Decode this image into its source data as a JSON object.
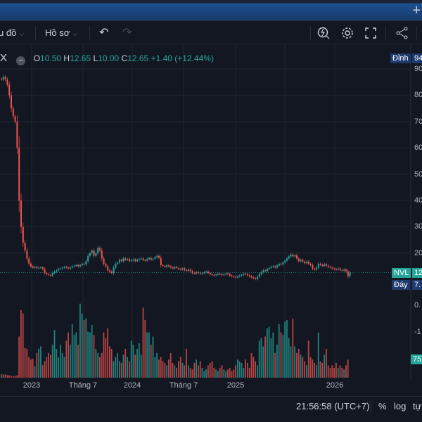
{
  "topbar": {
    "add_label": "+"
  },
  "toolbar": {
    "chart_menu": "u đồ",
    "profile_menu": "Hồ sơ",
    "undo": "↶",
    "redo": "↷"
  },
  "legend": {
    "symbol": "X",
    "o_label": "O",
    "o": "10.50",
    "h_label": "H",
    "h": "12.65",
    "l_label": "L",
    "l": "10.00",
    "c_label": "C",
    "c": "12.65",
    "change": "+1.40 (+12.44%)"
  },
  "price_axis": {
    "labels": [
      "90",
      "80",
      "70",
      "60",
      "50",
      "40",
      "30",
      "20"
    ],
    "high_label": "Đỉnh",
    "high_value": "94",
    "symbol_tag": "NVL",
    "last_value": "12",
    "low_label": "Đáy",
    "low_value": "7.",
    "osc_labels": [
      "0.",
      "-1"
    ],
    "volume_tag": "75"
  },
  "time_axis": [
    "2023",
    "Tháng 7",
    "2024",
    "Tháng 7",
    "2025",
    "2026"
  ],
  "bottom": {
    "time": "21:56:58 (UTC+7)",
    "percent": "%",
    "log": "log",
    "auto": "tự"
  },
  "colors": {
    "up": "#26a69a",
    "down": "#ef5350",
    "bg": "#131722",
    "accent": "#1e4f8f"
  },
  "chart_data": {
    "type": "candlestick",
    "symbol": "NVL",
    "interval": "weekly",
    "ylim": [
      0,
      95
    ],
    "closes": [
      86,
      87,
      86,
      84,
      80,
      75,
      72,
      70,
      60,
      40,
      30,
      24,
      21,
      18,
      16,
      15,
      14.5,
      14.8,
      14.3,
      14.5,
      14.6,
      14,
      12.5,
      12,
      11.8,
      11.5,
      12.5,
      13,
      13.5,
      14,
      14.2,
      14.5,
      14.8,
      14.5,
      14.2,
      14.6,
      15,
      15.2,
      15.5,
      15,
      15.5,
      16,
      15.8,
      17,
      19,
      20,
      21,
      19,
      20,
      22,
      21,
      18,
      16,
      15,
      13.5,
      13,
      12.5,
      14.5,
      16,
      16.5,
      17.5,
      17,
      18,
      17.5,
      17.8,
      17,
      17.3,
      17.6,
      17,
      17.5,
      17.8,
      18,
      17.4,
      17.2,
      17.8,
      18.2,
      17.5,
      17.9,
      18.5,
      19,
      18.2,
      15.5,
      15.2,
      14.8,
      15.4,
      15,
      14.6,
      14.2,
      14.8,
      14.4,
      14,
      13.8,
      14.2,
      13.6,
      13.3,
      13.8,
      13.2,
      12.5,
      12.3,
      12.8,
      12.6,
      12.2,
      12.4,
      12.8,
      13,
      12.5,
      12,
      11.8,
      11.6,
      11.9,
      12.2,
      12,
      11.7,
      12,
      12.3,
      12.1,
      11.5,
      11.2,
      11,
      10.8,
      11.2,
      11.5,
      11.8,
      12.2,
      12,
      11.6,
      11.2,
      10.8,
      10.5,
      10.2,
      11,
      12,
      12.8,
      13.5,
      13.2,
      14,
      14.4,
      14.8,
      15,
      14.6,
      15.3,
      16,
      15.8,
      16.5,
      17.2,
      18,
      18.8,
      19.5,
      18.8,
      19.2,
      18,
      17,
      17.5,
      16.8,
      16.2,
      16.8,
      16,
      15.5,
      14.2,
      13.8,
      14.5,
      16,
      15.6,
      15.2,
      15.8,
      15.3,
      14.8,
      14.5,
      14.2,
      14,
      13.8,
      14.2,
      13.6,
      13.4,
      13.8,
      13.2,
      11.25,
      12.65
    ],
    "volumes": [
      4,
      4,
      4,
      3,
      3,
      2,
      2,
      2,
      3,
      50,
      82,
      78,
      36,
      35,
      25,
      22,
      23,
      14,
      30,
      35,
      38,
      15,
      20,
      25,
      30,
      28,
      40,
      58,
      35,
      25,
      40,
      30,
      25,
      45,
      55,
      40,
      65,
      52,
      55,
      40,
      90,
      78,
      70,
      72,
      56,
      55,
      64,
      52,
      35,
      30,
      25,
      30,
      55,
      48,
      60,
      38,
      35,
      20,
      25,
      30,
      20,
      18,
      28,
      35,
      25,
      20,
      45,
      40,
      28,
      35,
      42,
      28,
      85,
      70,
      55,
      55,
      40,
      50,
      25,
      30,
      22,
      25,
      20,
      18,
      15,
      22,
      30,
      18,
      15,
      12,
      20,
      25,
      18,
      15,
      35,
      15,
      12,
      10,
      18,
      22,
      15,
      20,
      12,
      8,
      10,
      15,
      18,
      20,
      12,
      10,
      8,
      12,
      15,
      10,
      8,
      10,
      12,
      8,
      10,
      15,
      22,
      20,
      18,
      12,
      22,
      18,
      12,
      30,
      25,
      20,
      15,
      45,
      48,
      38,
      50,
      60,
      62,
      48,
      55,
      30,
      40,
      65,
      55,
      52,
      68,
      70,
      48,
      38,
      72,
      38,
      30,
      35,
      28,
      25,
      20,
      15,
      45,
      25,
      22,
      18,
      15,
      55,
      20,
      18,
      28,
      35,
      15,
      12,
      15,
      12,
      18,
      12,
      15,
      12,
      10,
      15,
      22
    ]
  }
}
